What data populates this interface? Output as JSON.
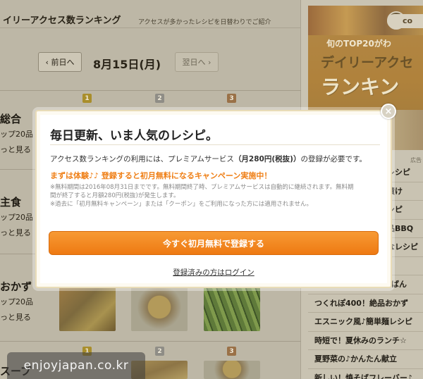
{
  "page": {
    "title": "イリーアクセス数ランキング",
    "subtitle": "アクセスが多かったレシピを日替わりでご紹介"
  },
  "datebar": {
    "prev_label": "前日へ",
    "date": "8月15日(月)",
    "next_label": "翌日へ"
  },
  "medals": [
    "1",
    "2",
    "3"
  ],
  "categories": [
    {
      "name": "総合",
      "sub": "ップ20品",
      "more": "っと見る"
    },
    {
      "name": "主食",
      "sub": "ップ20品",
      "more": "っと見る"
    },
    {
      "name": "おかず",
      "sub": "ップ20品",
      "more": "っと見る"
    },
    {
      "name": "スープ",
      "sub": "",
      "more": ""
    }
  ],
  "sidebar": {
    "banner_line1": "旬のTOP20がわ",
    "banner_line2": "デイリーアクセ",
    "banner_line3": "ランキン",
    "banner_logo": "co",
    "ad_tag": "広告",
    "items": [
      "レシピ",
      "漬け",
      "シピ",
      "品BBQ",
      "なレシピ",
      "♪",
      "ばん",
      "つくれぽ400！絶品おかず",
      "エスニック風♪簡単麺レシピ",
      "時短で！夏休みのランチ☆",
      "夏野菜の♪かんたん献立",
      "新しい！焼そばフレーバー♪"
    ]
  },
  "modal": {
    "title": "毎日更新、いま人気のレシピ。",
    "desc_prefix": "アクセス数ランキングの利用には、プレミアムサービス",
    "desc_price": "（月280円(税抜)）",
    "desc_suffix": "の登録が必要です。",
    "promo": "まずは体験♪♪ 登録すると初月無料になるキャンペーン実施中！",
    "note1": "※無料期間は2016年08月31日までです。無料期間終了時、プレミアムサービスは自動的に継続されます。無料期",
    "note2": "間が終了すると月額280円(税抜)が発生します。",
    "note3": "※過去に「初月無料キャンペーン」または「クーポン」をご利用になった方には適用されません。",
    "cta_label": "今すぐ初月無料で登録する",
    "login_label": "登録済みの方はログイン",
    "close_label": "×"
  },
  "watermark": "enjoyjapan.co.kr",
  "colors": {
    "cta_orange": "#ee7a12",
    "promo_orange": "#ef7f16",
    "modal_border": "#e9dcb7"
  }
}
